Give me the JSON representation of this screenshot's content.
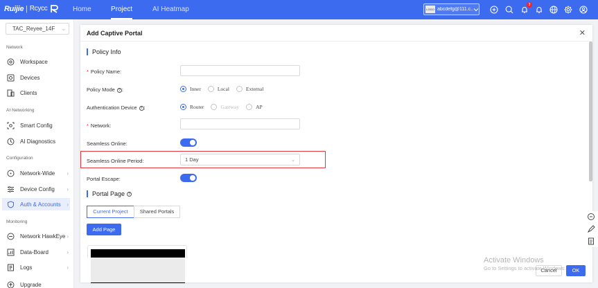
{
  "topbar": {
    "brand": "Ruijie",
    "brand_sub": "Rcycc",
    "tabs": [
      {
        "label": "Home"
      },
      {
        "label": "Project"
      },
      {
        "label": "AI Heatmap"
      }
    ],
    "account": {
      "logo_text": "LOGO",
      "name": "abcdefg@111.c..."
    },
    "notification_count": "3",
    "icons": [
      "add-circle-icon",
      "search-icon",
      "bell-badge-icon",
      "bell-icon",
      "globe-icon",
      "settings-icon",
      "user-icon"
    ]
  },
  "sidebar": {
    "project": "TAC_Reyee_14F",
    "sections": [
      {
        "title": "Network",
        "items": [
          {
            "label": "Workspace"
          },
          {
            "label": "Devices"
          },
          {
            "label": "Clients"
          }
        ]
      },
      {
        "title": "AI Networking",
        "items": [
          {
            "label": "Smart Config"
          },
          {
            "label": "AI Diagnostics"
          }
        ]
      },
      {
        "title": "Configuration",
        "items": [
          {
            "label": "Network-Wide"
          },
          {
            "label": "Device Config"
          },
          {
            "label": "Auth & Accounts"
          }
        ]
      },
      {
        "title": "Monitoring",
        "items": [
          {
            "label": "Network HawkEye"
          },
          {
            "label": "Data-Board"
          },
          {
            "label": "Logs"
          },
          {
            "label": "Upgrade"
          }
        ]
      }
    ]
  },
  "panel": {
    "title": "Add Captive Portal",
    "policy_info": "Policy Info",
    "fields": {
      "policy_name": {
        "label": "Policy Name:",
        "value": ""
      },
      "policy_mode": {
        "label": "Policy Mode",
        "colon": ":",
        "options": [
          "Inner",
          "Local",
          "External"
        ],
        "selected": "Inner"
      },
      "auth_device": {
        "label": "Authentication Device",
        "colon": ":",
        "options": [
          "Router",
          "Gateway",
          "AP"
        ],
        "selected": "Router"
      },
      "network": {
        "label": "Network:",
        "value": ""
      },
      "seamless_online": {
        "label": "Seamless Online:",
        "on": true
      },
      "seamless_period": {
        "label": "Seamless Online Period:",
        "value": "1 Day"
      },
      "portal_escape": {
        "label": "Portal Escape:",
        "on": true
      }
    },
    "portal_page": {
      "title": "Portal Page",
      "tabs": [
        "Current Project",
        "Shared Portals"
      ],
      "add_page": "Add Page"
    },
    "footer": {
      "cancel": "Cancel",
      "ok": "OK"
    }
  },
  "watermark": {
    "line1": "Activate Windows",
    "line2": "Go to Settings to activate Windows."
  },
  "colors": {
    "primary": "#3d6bf0",
    "highlight": "#e5363b",
    "required": "#f5222d"
  }
}
